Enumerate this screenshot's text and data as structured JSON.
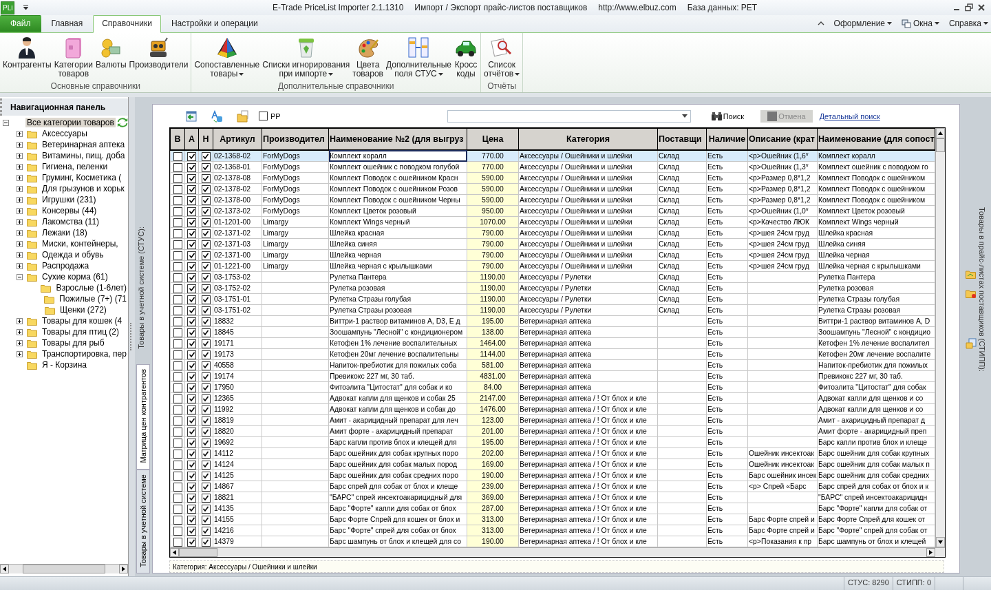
{
  "window": {
    "app_name": "E-Trade PriceList Importer 2.1.1310",
    "subtitle": "Импорт / Экспорт прайс-листов поставщиков",
    "url": "http://www.elbuz.com",
    "database": "База данных: PET",
    "logo": "PLi"
  },
  "ribbon_tabs": [
    {
      "label": "Файл",
      "kind": "file",
      "selected": false
    },
    {
      "label": "Главная",
      "kind": "tab",
      "selected": false
    },
    {
      "label": "Справочники",
      "kind": "tab",
      "selected": true
    },
    {
      "label": "Настройки и операции",
      "kind": "tab",
      "selected": false
    }
  ],
  "ribbon_menus": [
    {
      "label": "Оформление"
    },
    {
      "label": "Окна"
    },
    {
      "label": "Справка"
    }
  ],
  "ribbon_groups": [
    {
      "label": "Основные справочники",
      "buttons": [
        {
          "lines": [
            "Контрагенты"
          ],
          "dropdown": false
        },
        {
          "lines": [
            "Категории",
            "товаров"
          ],
          "dropdown": false
        },
        {
          "lines": [
            "Валюты"
          ],
          "dropdown": false
        },
        {
          "lines": [
            "Производители"
          ],
          "dropdown": false
        }
      ]
    },
    {
      "label": "Дополнительные справочники",
      "buttons": [
        {
          "lines": [
            "Сопоставленные",
            "товары"
          ],
          "dropdown": true
        },
        {
          "lines": [
            "Списки игнорирования",
            "при импорте"
          ],
          "dropdown": true
        },
        {
          "lines": [
            "Цвета",
            "товаров"
          ],
          "dropdown": false
        },
        {
          "lines": [
            "Дополнительные",
            "поля СТУС"
          ],
          "dropdown": true
        },
        {
          "lines": [
            "Кросс",
            "коды"
          ],
          "dropdown": false
        }
      ]
    },
    {
      "label": "Отчёты",
      "buttons": [
        {
          "lines": [
            "Список",
            "отчётов"
          ],
          "dropdown": true
        }
      ]
    }
  ],
  "nav_panel": {
    "title": "Навигационная панель",
    "tree": [
      {
        "label": "Все категории товаров",
        "selected": true,
        "expanded": true,
        "children": [
          {
            "label": "Аксессуары",
            "selected": false,
            "expanded": false
          },
          {
            "label": "Ветеринарная аптека",
            "selected": false,
            "expanded": false
          },
          {
            "label": "Витамины, пищ. доба",
            "selected": false,
            "expanded": false
          },
          {
            "label": "Гигиена, пеленки",
            "selected": false,
            "expanded": false
          },
          {
            "label": "Груминг, Косметика (",
            "selected": false,
            "expanded": false
          },
          {
            "label": "Для грызунов и хорьк",
            "selected": false,
            "expanded": false
          },
          {
            "label": "Игрушки (231)",
            "selected": false,
            "expanded": false
          },
          {
            "label": "Консервы (44)",
            "selected": false,
            "expanded": false
          },
          {
            "label": "Лакомства (11)",
            "selected": false,
            "expanded": false
          },
          {
            "label": "Лежаки (18)",
            "selected": false,
            "expanded": false
          },
          {
            "label": "Миски, контейнеры,",
            "selected": false,
            "expanded": false
          },
          {
            "label": "Одежда и обувь",
            "selected": false,
            "expanded": false
          },
          {
            "label": "Распродажа",
            "selected": false,
            "expanded": false
          },
          {
            "label": "Сухие корма (61)",
            "selected": false,
            "expanded": true,
            "children": [
              {
                "label": "Взрослые (1-6лет)",
                "selected": false
              },
              {
                "label": "Пожилые (7+) (71",
                "selected": false
              },
              {
                "label": "Щенки (272)",
                "selected": false
              }
            ]
          },
          {
            "label": "Товары для кошек (4",
            "selected": false,
            "expanded": false
          },
          {
            "label": "Товары для птиц (2)",
            "selected": false,
            "expanded": false
          },
          {
            "label": "Товары для рыб",
            "selected": false,
            "expanded": false
          },
          {
            "label": "Транспортировка, пер",
            "selected": false,
            "expanded": false
          },
          {
            "label": "Я - Корзина",
            "selected": false
          }
        ]
      }
    ]
  },
  "left_caption": "Товары в учетной системе (СТУС):",
  "side_tabs": [
    {
      "label": "Матрица цен контрагентов",
      "selected": true
    },
    {
      "label": "Товары в учетной системе",
      "selected": false
    }
  ],
  "right_caption": "Товары в прайс-листах поставщиков (СТИПП):",
  "toolbar": {
    "pp_label": "PP",
    "pp_checked": false,
    "search_button": "Поиск",
    "cancel_button": "Отмена",
    "cancel_disabled": true,
    "detail_link": "Детальный поиск"
  },
  "table": {
    "columns": [
      "В",
      "А",
      "Н",
      "Артикул",
      "Производител",
      "Наименование №2 (для выгруз",
      "Цена",
      "Категория",
      "Поставщи",
      "Наличие",
      "Описание (крат",
      "Наименование (для сопост"
    ],
    "rows": [
      {
        "selected": true,
        "b_checked": false,
        "a_checked": true,
        "h_checked": true,
        "article": "02-1368-02",
        "maker": "ForMyDogs",
        "name2": "Комплект коралл",
        "price": "770.00",
        "category": "Аксессуары / Ошейники и шлейки",
        "supplier": "Склад",
        "stock": "Есть",
        "description": "<p>Ошейник (1,6*",
        "name": "Комплект коралл"
      },
      {
        "selected": false,
        "b_checked": false,
        "a_checked": true,
        "h_checked": true,
        "article": "02-1368-01",
        "maker": "ForMyDogs",
        "name2": "Комплект ошейник с поводком голубой",
        "price": "770.00",
        "category": "Аксессуары / Ошейники и шлейки",
        "supplier": "Склад",
        "stock": "Есть",
        "description": "<p>Ошейник (1,3*",
        "name": "Комплект ошейник с поводком го"
      },
      {
        "selected": false,
        "b_checked": false,
        "a_checked": true,
        "h_checked": true,
        "article": "02-1378-08",
        "maker": "ForMyDogs",
        "name2": "Комплект Поводок с ошейником Красн",
        "price": "590.00",
        "category": "Аксессуары / Ошейники и шлейки",
        "supplier": "Склад",
        "stock": "Есть",
        "description": "<p>Размер 0,8*1,2",
        "name": "Комплект Поводок с ошейником"
      },
      {
        "selected": false,
        "b_checked": false,
        "a_checked": true,
        "h_checked": true,
        "article": "02-1378-02",
        "maker": "ForMyDogs",
        "name2": "Комплект Поводок с ошейником Розов",
        "price": "590.00",
        "category": "Аксессуары / Ошейники и шлейки",
        "supplier": "Склад",
        "stock": "Есть",
        "description": "<p>Размер 0,8*1,2",
        "name": "Комплект Поводок с ошейником"
      },
      {
        "selected": false,
        "b_checked": false,
        "a_checked": true,
        "h_checked": true,
        "article": "02-1378-00",
        "maker": "ForMyDogs",
        "name2": "Комплект Поводок с ошейником Черны",
        "price": "590.00",
        "category": "Аксессуары / Ошейники и шлейки",
        "supplier": "Склад",
        "stock": "Есть",
        "description": "<p>Размер 0,8*1,2",
        "name": "Комплект Поводок с ошейником"
      },
      {
        "selected": false,
        "b_checked": false,
        "a_checked": true,
        "h_checked": true,
        "article": "02-1373-02",
        "maker": "ForMyDogs",
        "name2": "Комплект Цветок розовый",
        "price": "950.00",
        "category": "Аксессуары / Ошейники и шлейки",
        "supplier": "Склад",
        "stock": "Есть",
        "description": "<p>Ошейник (1,0*",
        "name": "Комплект Цветок розовый"
      },
      {
        "selected": false,
        "b_checked": false,
        "a_checked": true,
        "h_checked": true,
        "article": "01-1201-00",
        "maker": "Limargy",
        "name2": "Комплект Wings черный",
        "price": "1070.00",
        "category": "Аксессуары / Ошейники и шлейки",
        "supplier": "Склад",
        "stock": "Есть",
        "description": "<p>Качество ЛЮК",
        "name": "Комплект Wings черный"
      },
      {
        "selected": false,
        "b_checked": false,
        "a_checked": true,
        "h_checked": true,
        "article": "02-1371-02",
        "maker": "Limargy",
        "name2": "Шлейка красная",
        "price": "790.00",
        "category": "Аксессуары / Ошейники и шлейки",
        "supplier": "Склад",
        "stock": "Есть",
        "description": "<p>шея 24см груд",
        "name": "Шлейка красная"
      },
      {
        "selected": false,
        "b_checked": false,
        "a_checked": true,
        "h_checked": true,
        "article": "02-1371-03",
        "maker": "Limargy",
        "name2": "Шлейка синяя",
        "price": "790.00",
        "category": "Аксессуары / Ошейники и шлейки",
        "supplier": "Склад",
        "stock": "Есть",
        "description": "<p>шея 24см груд",
        "name": "Шлейка синяя"
      },
      {
        "selected": false,
        "b_checked": false,
        "a_checked": true,
        "h_checked": true,
        "article": "02-1371-00",
        "maker": "Limargy",
        "name2": "Шлейка черная",
        "price": "790.00",
        "category": "Аксессуары / Ошейники и шлейки",
        "supplier": "Склад",
        "stock": "Есть",
        "description": "<p>шея 24см груд",
        "name": "Шлейка черная"
      },
      {
        "selected": false,
        "b_checked": false,
        "a_checked": true,
        "h_checked": true,
        "article": "01-1221-00",
        "maker": "Limargy",
        "name2": "Шлейка черная с крылышками",
        "price": "790.00",
        "category": "Аксессуары / Ошейники и шлейки",
        "supplier": "Склад",
        "stock": "Есть",
        "description": "<p>шея 24см груд",
        "name": "Шлейка черная с крылышками"
      },
      {
        "selected": false,
        "b_checked": false,
        "a_checked": true,
        "h_checked": true,
        "article": "03-1753-02",
        "name2": "Рулетка Пантера",
        "price": "1190.00",
        "category": "Аксессуары / Рулетки",
        "supplier": "Склад",
        "stock": "Есть",
        "name": "Рулетка Пантера"
      },
      {
        "selected": false,
        "b_checked": false,
        "a_checked": true,
        "h_checked": true,
        "article": "03-1752-02",
        "name2": "Рулетка розовая",
        "price": "1190.00",
        "category": "Аксессуары / Рулетки",
        "supplier": "Склад",
        "stock": "Есть",
        "name": "Рулетка розовая"
      },
      {
        "selected": false,
        "b_checked": false,
        "a_checked": true,
        "h_checked": true,
        "article": "03-1751-01",
        "name2": "Рулетка Стразы голубая",
        "price": "1190.00",
        "category": "Аксессуары / Рулетки",
        "supplier": "Склад",
        "stock": "Есть",
        "name": "Рулетка Стразы голубая"
      },
      {
        "selected": false,
        "b_checked": false,
        "a_checked": true,
        "h_checked": true,
        "article": "03-1751-02",
        "name2": "Рулетка Стразы розовая",
        "price": "1190.00",
        "category": "Аксессуары / Рулетки",
        "supplier": "Склад",
        "stock": "Есть",
        "name": "Рулетка Стразы розовая"
      },
      {
        "selected": false,
        "b_checked": false,
        "a_checked": true,
        "h_checked": true,
        "article": "18832",
        "name2": "Виттри-1 раствор витаминов А, D3, Е д",
        "price": "195.00",
        "category": "Ветеринарная аптека",
        "stock": "Есть",
        "name": "Виттри-1 раствор витаминов А, D"
      },
      {
        "selected": false,
        "b_checked": false,
        "a_checked": true,
        "h_checked": true,
        "article": "18845",
        "name2": "Зоошампунь \"Лесной\" с кондиционером",
        "price": "138.00",
        "category": "Ветеринарная аптека",
        "stock": "Есть",
        "name": "Зоошампунь \"Лесной\" с кондицио"
      },
      {
        "selected": false,
        "b_checked": false,
        "a_checked": true,
        "h_checked": true,
        "article": "19171",
        "name2": "Кетофен 1% лечение воспалительных",
        "price": "1464.00",
        "category": "Ветеринарная аптека",
        "stock": "Есть",
        "name": "Кетофен 1% лечение воспалител"
      },
      {
        "selected": false,
        "b_checked": false,
        "a_checked": true,
        "h_checked": true,
        "article": "19173",
        "name2": "Кетофен 20мг лечение воспалительны",
        "price": "1144.00",
        "category": "Ветеринарная аптека",
        "stock": "Есть",
        "name": "Кетофен 20мг лечение воспалите"
      },
      {
        "selected": false,
        "b_checked": false,
        "a_checked": true,
        "h_checked": true,
        "article": "40558",
        "name2": "Напиток-пребиотик для пожилых соба",
        "price": "581.00",
        "category": "Ветеринарная аптека",
        "stock": "Есть",
        "name": "Напиток-пребиотик для пожилых"
      },
      {
        "selected": false,
        "b_checked": false,
        "a_checked": true,
        "h_checked": true,
        "article": "19174",
        "name2": "Превикокс 227 мг, 30 таб.",
        "price": "4831.00",
        "category": "Ветеринарная аптека",
        "stock": "Есть",
        "name": "Превикокс 227 мг, 30 таб."
      },
      {
        "selected": false,
        "b_checked": false,
        "a_checked": true,
        "h_checked": true,
        "article": "17950",
        "name2": "Фитоэлита \"Цитостат\" для собак и ко",
        "price": "84.00",
        "category": "Ветеринарная аптека",
        "stock": "Есть",
        "name": "Фитоэлита \"Цитостат\" для собак"
      },
      {
        "selected": false,
        "b_checked": false,
        "a_checked": true,
        "h_checked": true,
        "article": "12365",
        "name2": "Адвокат капли для щенков и собак 25",
        "price": "2147.00",
        "category": "Ветеринарная аптека / ! От блох и кле",
        "stock": "Есть",
        "name": "Адвокат капли для щенков и со"
      },
      {
        "selected": false,
        "b_checked": false,
        "a_checked": true,
        "h_checked": true,
        "article": "11992",
        "name2": "Адвокат капли для щенков и собак до",
        "price": "1476.00",
        "category": "Ветеринарная аптека / ! От блох и кле",
        "stock": "Есть",
        "name": "Адвокат капли для щенков и со"
      },
      {
        "selected": false,
        "b_checked": false,
        "a_checked": true,
        "h_checked": true,
        "article": "18819",
        "name2": "Амит - акарицидный препарат для леч",
        "price": "123.00",
        "category": "Ветеринарная аптека / ! От блох и кле",
        "stock": "Есть",
        "name": "Амит - акарицидный препарат д"
      },
      {
        "selected": false,
        "b_checked": false,
        "a_checked": true,
        "h_checked": true,
        "article": "18820",
        "name2": "Амит форте - акарицидный препарат",
        "price": "201.00",
        "category": "Ветеринарная аптека / ! От блох и кле",
        "stock": "Есть",
        "name": "Амит форте - акарицидный преп"
      },
      {
        "selected": false,
        "b_checked": false,
        "a_checked": true,
        "h_checked": true,
        "article": "19692",
        "name2": "Барс капли против блох и клещей для",
        "price": "195.00",
        "category": "Ветеринарная аптека / ! От блох и кле",
        "stock": "Есть",
        "name": "Барс капли против блох и клеще"
      },
      {
        "selected": false,
        "b_checked": false,
        "a_checked": true,
        "h_checked": true,
        "article": "14112",
        "name2": "Барс ошейник для собак крупных поро",
        "price": "202.00",
        "category": "Ветеринарная аптека / ! От блох и кле",
        "stock": "Есть",
        "description": "Ошейник инсектоак",
        "name": "Барс ошейник для собак крупных"
      },
      {
        "selected": false,
        "b_checked": false,
        "a_checked": true,
        "h_checked": true,
        "article": "14124",
        "name2": "Барс ошейник для собак малых пород",
        "price": "169.00",
        "category": "Ветеринарная аптека / ! От блох и кле",
        "stock": "Есть",
        "description": "Ошейник инсектоак",
        "name": "Барс ошейник для собак малых п"
      },
      {
        "selected": false,
        "b_checked": false,
        "a_checked": true,
        "h_checked": true,
        "article": "14125",
        "name2": "Барс ошейник для собак средних поро",
        "price": "190.00",
        "category": "Ветеринарная аптека / ! От блох и кле",
        "stock": "Есть",
        "description": "Барс ошейник инсек",
        "name": "Барс ошейник для собак средних"
      },
      {
        "selected": false,
        "b_checked": false,
        "a_checked": true,
        "h_checked": true,
        "article": "14867",
        "name2": "Барс спрей для собак от блох и клеще",
        "price": "239.00",
        "category": "Ветеринарная аптека / ! От блох и кле",
        "stock": "Есть",
        "description": "<p>    Спрей «Барс",
        "name": "Барс спрей для собак от блох и к"
      },
      {
        "selected": false,
        "b_checked": false,
        "a_checked": true,
        "h_checked": true,
        "article": "18821",
        "name2": "\"БАРС\" спрей инсектоакарицидный для",
        "price": "369.00",
        "category": "Ветеринарная аптека / ! От блох и кле",
        "stock": "Есть",
        "name": "\"БАРС\" спрей инсектоакарицидн"
      },
      {
        "selected": false,
        "b_checked": false,
        "a_checked": true,
        "h_checked": true,
        "article": "14135",
        "name2": "Барс \"Форте\" капли для собак от блох",
        "price": "287.00",
        "category": "Ветеринарная аптека / ! От блох и кле",
        "stock": "Есть",
        "name": "Барс \"Форте\" капли для собак от"
      },
      {
        "selected": false,
        "b_checked": false,
        "a_checked": true,
        "h_checked": true,
        "article": "14155",
        "name2": "Барс Форте Спрей для кошек от блох и",
        "price": "313.00",
        "category": "Ветеринарная аптека / ! От блох и кле",
        "stock": "Есть",
        "description": "Барс Форте спрей и",
        "name": "Барс Форте Спрей для кошек от"
      },
      {
        "selected": false,
        "b_checked": false,
        "a_checked": true,
        "h_checked": true,
        "article": "14216",
        "name2": "Барс \"Форте\" спрей для собак от блох",
        "price": "313.00",
        "category": "Ветеринарная аптека / ! От блох и кле",
        "stock": "Есть",
        "description": "Барс Форте спрей и",
        "name": "Барс \"Форте\" спрей для собак от"
      },
      {
        "selected": false,
        "b_checked": false,
        "a_checked": true,
        "h_checked": true,
        "article": "14379",
        "name2": "Барс шампунь от блох и клещей для со",
        "price": "190.00",
        "category": "Ветеринарная аптека / ! От блох и кле",
        "stock": "Есть",
        "description": "<p>Показания к пр",
        "name": "Барс шампунь от блох и клещей"
      }
    ]
  },
  "footer_text": "Категория: Аксессуары / Ошейники и шлейки",
  "status_bar": [
    "СТУС: 8290",
    "СТИПП: 0"
  ]
}
